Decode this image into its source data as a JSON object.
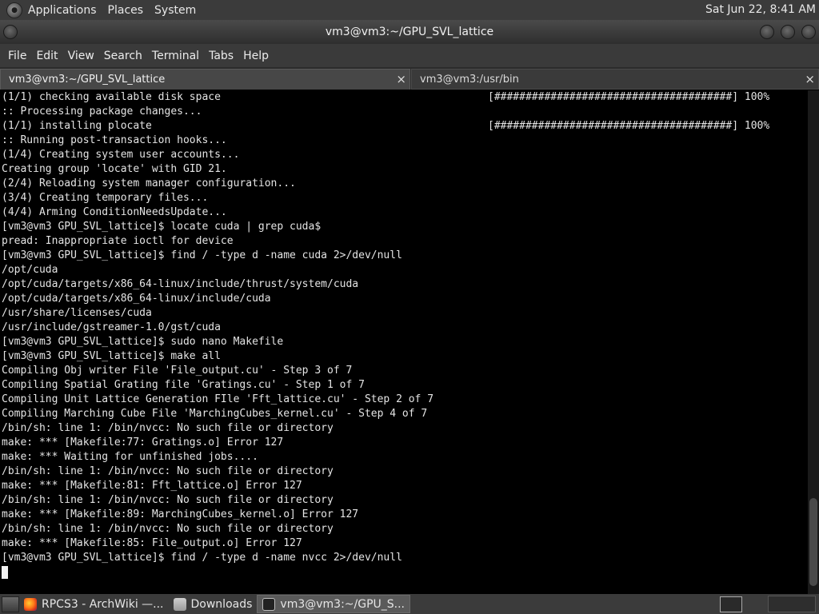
{
  "top_panel": {
    "menus": [
      "Applications",
      "Places",
      "System"
    ],
    "clock": "Sat Jun 22,  8:41 AM"
  },
  "window": {
    "title": "vm3@vm3:~/GPU_SVL_lattice"
  },
  "menubar": [
    "File",
    "Edit",
    "View",
    "Search",
    "Terminal",
    "Tabs",
    "Help"
  ],
  "tabs": [
    {
      "label": "vm3@vm3:~/GPU_SVL_lattice",
      "close": "×"
    },
    {
      "label": "vm3@vm3:/usr/bin",
      "close": "×"
    }
  ],
  "terminal": {
    "lines": [
      {
        "text": "(1/1) checking available disk space",
        "progress": "[######################################] 100%"
      },
      {
        "text": ":: Processing package changes...",
        "progress": ""
      },
      {
        "text": "(1/1) installing plocate",
        "progress": "[######################################] 100%"
      },
      {
        "text": ":: Running post-transaction hooks...",
        "progress": ""
      },
      {
        "text": "(1/4) Creating system user accounts...",
        "progress": ""
      },
      {
        "text": "Creating group 'locate' with GID 21.",
        "progress": ""
      },
      {
        "text": "(2/4) Reloading system manager configuration...",
        "progress": ""
      },
      {
        "text": "(3/4) Creating temporary files...",
        "progress": ""
      },
      {
        "text": "(4/4) Arming ConditionNeedsUpdate...",
        "progress": ""
      },
      {
        "text": "[vm3@vm3 GPU_SVL_lattice]$ locate cuda | grep cuda$",
        "progress": ""
      },
      {
        "text": "pread: Inappropriate ioctl for device",
        "progress": ""
      },
      {
        "text": "[vm3@vm3 GPU_SVL_lattice]$ find / -type d -name cuda 2>/dev/null",
        "progress": ""
      },
      {
        "text": "/opt/cuda",
        "progress": ""
      },
      {
        "text": "/opt/cuda/targets/x86_64-linux/include/thrust/system/cuda",
        "progress": ""
      },
      {
        "text": "/opt/cuda/targets/x86_64-linux/include/cuda",
        "progress": ""
      },
      {
        "text": "/usr/share/licenses/cuda",
        "progress": ""
      },
      {
        "text": "/usr/include/gstreamer-1.0/gst/cuda",
        "progress": ""
      },
      {
        "text": "[vm3@vm3 GPU_SVL_lattice]$ sudo nano Makefile",
        "progress": ""
      },
      {
        "text": "[vm3@vm3 GPU_SVL_lattice]$ make all",
        "progress": ""
      },
      {
        "text": "Compiling Obj writer File 'File_output.cu' - Step 3 of 7",
        "progress": ""
      },
      {
        "text": "Compiling Spatial Grating file 'Gratings.cu' - Step 1 of 7",
        "progress": ""
      },
      {
        "text": "Compiling Unit Lattice Generation FIle 'Fft_lattice.cu' - Step 2 of 7",
        "progress": ""
      },
      {
        "text": "Compiling Marching Cube File 'MarchingCubes_kernel.cu' - Step 4 of 7",
        "progress": ""
      },
      {
        "text": "/bin/sh: line 1: /bin/nvcc: No such file or directory",
        "progress": ""
      },
      {
        "text": "make: *** [Makefile:77: Gratings.o] Error 127",
        "progress": ""
      },
      {
        "text": "make: *** Waiting for unfinished jobs....",
        "progress": ""
      },
      {
        "text": "/bin/sh: line 1: /bin/nvcc: No such file or directory",
        "progress": ""
      },
      {
        "text": "make: *** [Makefile:81: Fft_lattice.o] Error 127",
        "progress": ""
      },
      {
        "text": "/bin/sh: line 1: /bin/nvcc: No such file or directory",
        "progress": ""
      },
      {
        "text": "make: *** [Makefile:89: MarchingCubes_kernel.o] Error 127",
        "progress": ""
      },
      {
        "text": "/bin/sh: line 1: /bin/nvcc: No such file or directory",
        "progress": ""
      },
      {
        "text": "make: *** [Makefile:85: File_output.o] Error 127",
        "progress": ""
      },
      {
        "text": "[vm3@vm3 GPU_SVL_lattice]$ find / -type d -name nvcc 2>/dev/null",
        "progress": ""
      }
    ]
  },
  "taskbar": {
    "items": [
      {
        "label": "RPCS3 - ArchWiki —...",
        "icon": "firefox-icon"
      },
      {
        "label": "Downloads",
        "icon": "folder-icon"
      },
      {
        "label": "vm3@vm3:~/GPU_S...",
        "icon": "terminal-icon"
      }
    ]
  }
}
